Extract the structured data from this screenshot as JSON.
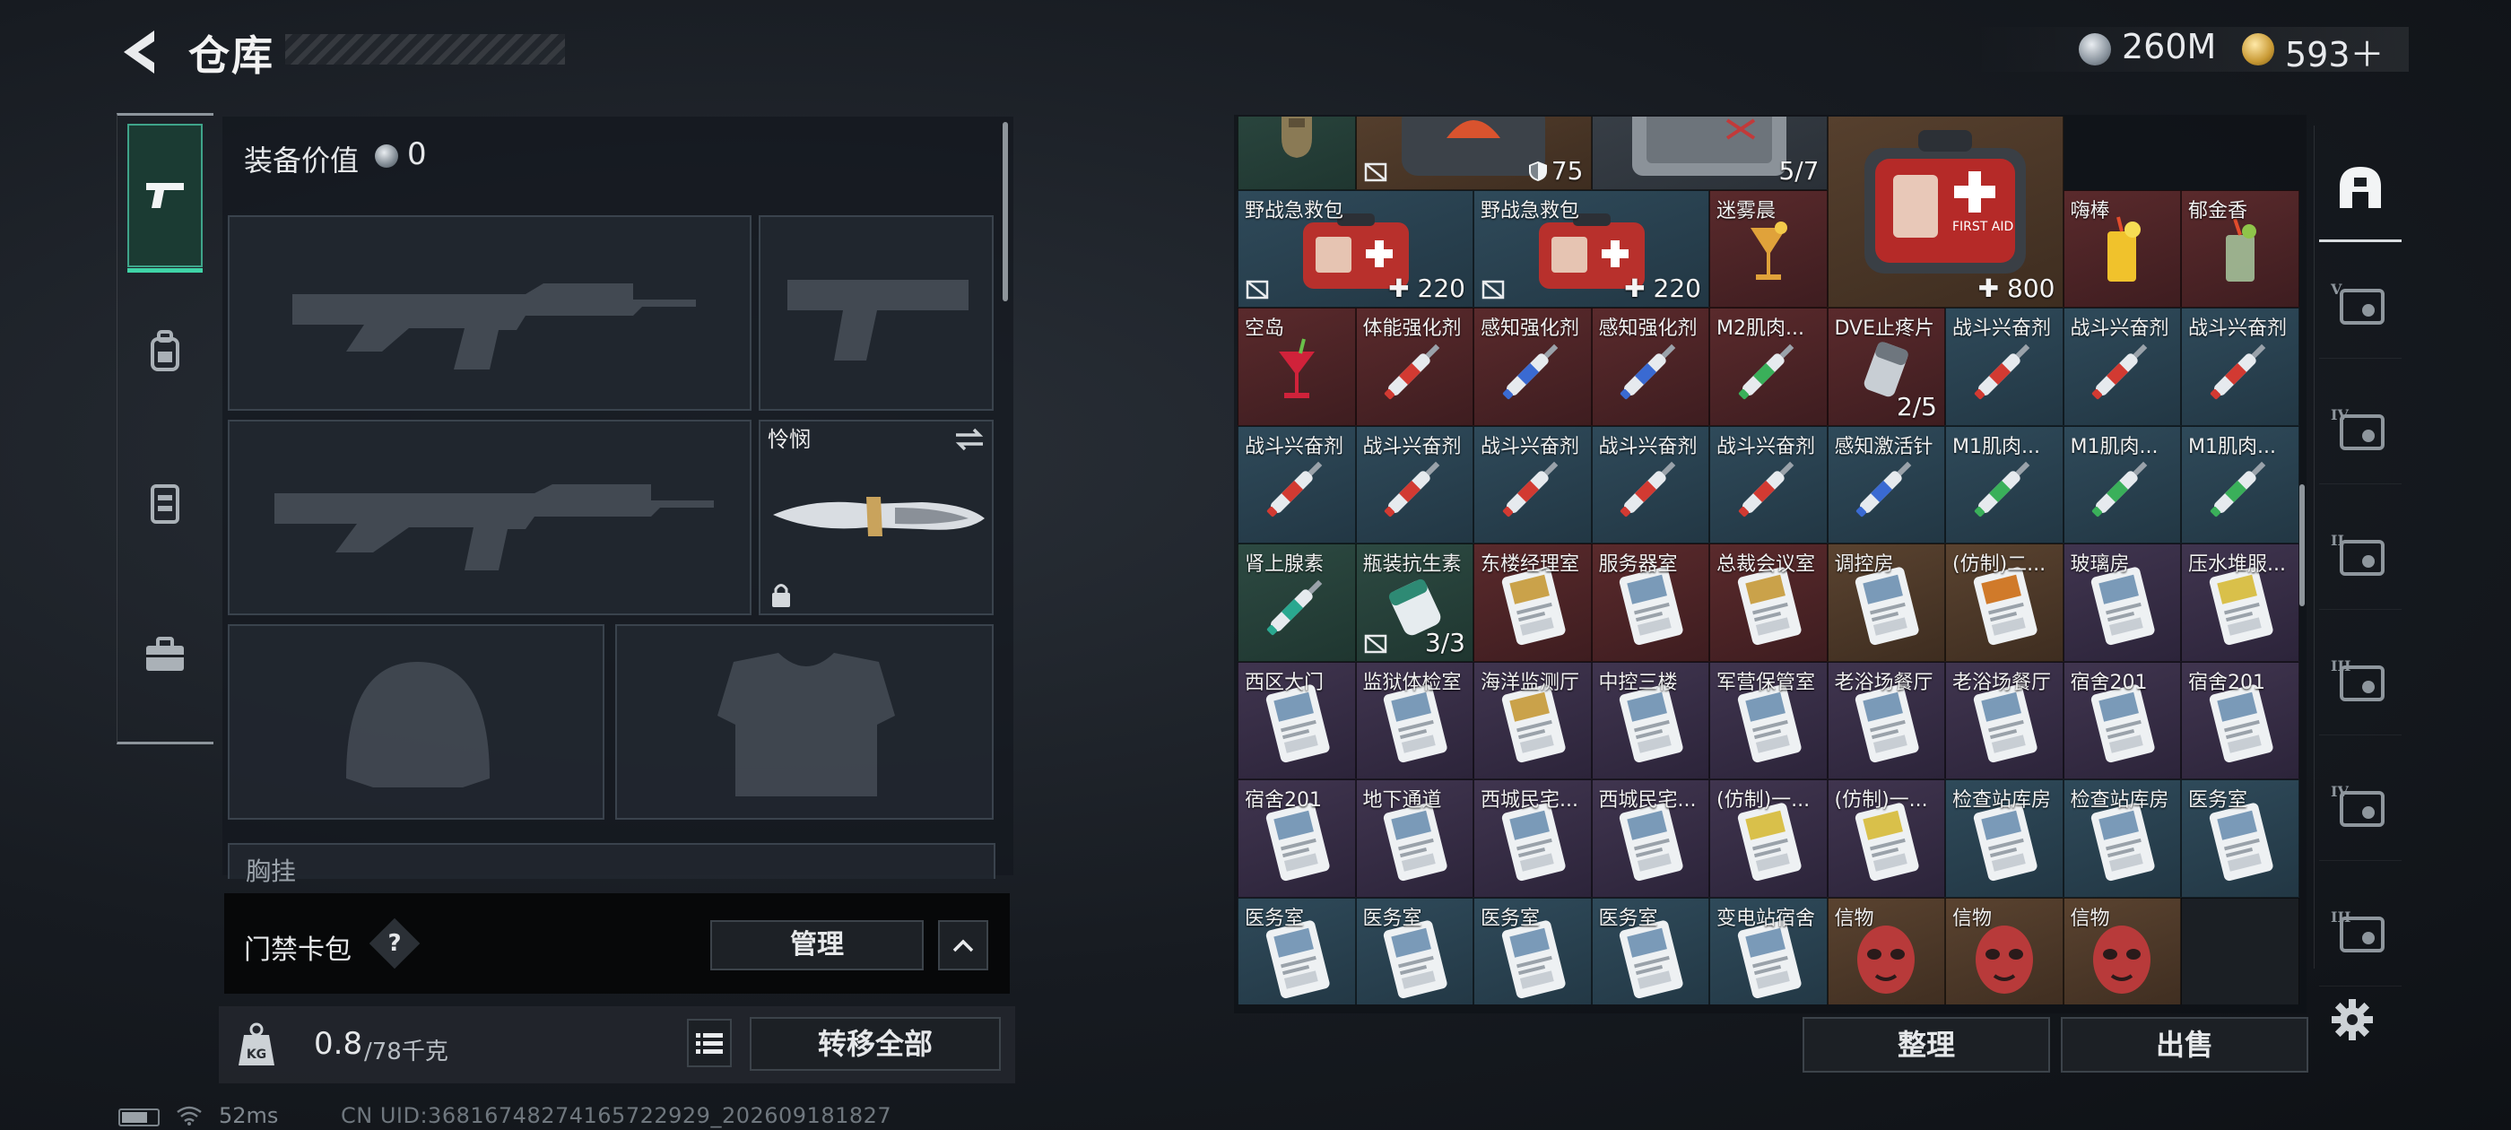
{
  "header": {
    "title": "仓库",
    "currency": [
      {
        "name": "silver",
        "icon": "silver-coin-icon",
        "value": "260M"
      },
      {
        "name": "gold",
        "icon": "gold-coin-icon",
        "value": "593＋"
      }
    ]
  },
  "left_rail": {
    "tabs": [
      {
        "icon": "pistol-icon",
        "active": true
      },
      {
        "icon": "backpack-icon",
        "active": false
      },
      {
        "icon": "vest-icon",
        "active": false
      },
      {
        "icon": "toolbox-icon",
        "active": false
      }
    ]
  },
  "loadout": {
    "equip_value_label": "装备价值",
    "equip_value": "0",
    "melee_name": "怜悯",
    "chest_rig_label": "胸挂",
    "keycard_label": "门禁卡包",
    "keycard_help": "?",
    "manage_label": "管理",
    "weight_current": "0.8",
    "weight_max": "/78千克",
    "transfer_all_label": "转移全部"
  },
  "stash": {
    "rows": [
      [
        {
          "name": "",
          "bg": "green",
          "art": "holster",
          "w": 1
        },
        {
          "name": "",
          "bg": "brown",
          "art": "bag",
          "w": 2,
          "count": "75",
          "badge": "shield",
          "no_retrieve": true
        },
        {
          "name": "",
          "bg": "gray",
          "art": "case",
          "w": 2,
          "count": "5/7"
        },
        {
          "name": "",
          "bg": "brown",
          "art": "firstaid-big",
          "w": 2,
          "h": 2,
          "count": "800",
          "plus": true
        }
      ],
      [
        {
          "name": "野战急救包",
          "bg": "blue",
          "art": "firstaid",
          "w": 2,
          "count": "220",
          "plus": true,
          "no_retrieve": true
        },
        {
          "name": "野战急救包",
          "bg": "blue",
          "art": "firstaid",
          "w": 2,
          "count": "220",
          "plus": true,
          "no_retrieve": true
        },
        {
          "name": "迷雾晨",
          "bg": "red",
          "art": "cocktail"
        },
        {
          "name": "嗨棒",
          "bg": "red",
          "art": "drink-yellow"
        },
        {
          "name": "郁金香",
          "bg": "red",
          "art": "drink-green"
        }
      ],
      [
        {
          "name": "空岛",
          "bg": "red",
          "art": "cocktail-red"
        },
        {
          "name": "体能强化剂",
          "bg": "red",
          "art": "inj-red"
        },
        {
          "name": "感知强化剂",
          "bg": "red",
          "art": "inj-blue"
        },
        {
          "name": "感知强化剂",
          "bg": "red",
          "art": "inj-blue"
        },
        {
          "name": "M2肌肉...",
          "bg": "red",
          "art": "inj-green"
        },
        {
          "name": "DVE止疼片",
          "bg": "red",
          "art": "pills",
          "count": "2/5"
        },
        {
          "name": "战斗兴奋剂",
          "bg": "blue",
          "art": "inj-red"
        },
        {
          "name": "战斗兴奋剂",
          "bg": "blue",
          "art": "inj-red"
        },
        {
          "name": "战斗兴奋剂",
          "bg": "blue",
          "art": "inj-red"
        }
      ],
      [
        {
          "name": "战斗兴奋剂",
          "bg": "blue",
          "art": "inj-red"
        },
        {
          "name": "战斗兴奋剂",
          "bg": "blue",
          "art": "inj-red"
        },
        {
          "name": "战斗兴奋剂",
          "bg": "blue",
          "art": "inj-red"
        },
        {
          "name": "战斗兴奋剂",
          "bg": "blue",
          "art": "inj-red"
        },
        {
          "name": "战斗兴奋剂",
          "bg": "blue",
          "art": "inj-red"
        },
        {
          "name": "感知激活针",
          "bg": "blue",
          "art": "inj-blue"
        },
        {
          "name": "M1肌肉...",
          "bg": "blue",
          "art": "inj-green"
        },
        {
          "name": "M1肌肉...",
          "bg": "blue",
          "art": "inj-green"
        },
        {
          "name": "M1肌肉...",
          "bg": "blue",
          "art": "inj-green"
        }
      ],
      [
        {
          "name": "肾上腺素",
          "bg": "green",
          "art": "inj-teal"
        },
        {
          "name": "瓶装抗生素",
          "bg": "green",
          "art": "bottle",
          "count": "3/3",
          "no_retrieve": true
        },
        {
          "name": "东楼经理室",
          "bg": "red",
          "art": "card-gold"
        },
        {
          "name": "服务器室",
          "bg": "red",
          "art": "card-blue"
        },
        {
          "name": "总裁会议室",
          "bg": "red",
          "art": "card-gold"
        },
        {
          "name": "调控房",
          "bg": "brown",
          "art": "card-blue"
        },
        {
          "name": "(仿制)二...",
          "bg": "brown",
          "art": "card-orange"
        },
        {
          "name": "玻璃房",
          "bg": "purple",
          "art": "card-blue"
        },
        {
          "name": "压水堆服...",
          "bg": "purple",
          "art": "card-yellow"
        }
      ],
      [
        {
          "name": "西区大门",
          "bg": "purple",
          "art": "card-blue"
        },
        {
          "name": "监狱体检室",
          "bg": "purple",
          "art": "card-blue"
        },
        {
          "name": "海洋监测厅",
          "bg": "purple",
          "art": "card-gold"
        },
        {
          "name": "中控三楼",
          "bg": "purple",
          "art": "card-blue"
        },
        {
          "name": "军营保管室",
          "bg": "purple",
          "art": "card-blue"
        },
        {
          "name": "老浴场餐厅",
          "bg": "purple",
          "art": "card-blue"
        },
        {
          "name": "老浴场餐厅",
          "bg": "purple",
          "art": "card-blue"
        },
        {
          "name": "宿舍201",
          "bg": "purple",
          "art": "card-blue"
        },
        {
          "name": "宿舍201",
          "bg": "purple",
          "art": "card-blue"
        }
      ],
      [
        {
          "name": "宿舍201",
          "bg": "purple",
          "art": "card-blue"
        },
        {
          "name": "地下通道",
          "bg": "purple",
          "art": "card-blue"
        },
        {
          "name": "西城民宅...",
          "bg": "purple",
          "art": "card-blue"
        },
        {
          "name": "西城民宅...",
          "bg": "purple",
          "art": "card-blue"
        },
        {
          "name": "(仿制)一...",
          "bg": "purple",
          "art": "card-yellow"
        },
        {
          "name": "(仿制)一...",
          "bg": "purple",
          "art": "card-yellow"
        },
        {
          "name": "检查站库房",
          "bg": "blue",
          "art": "card-blue"
        },
        {
          "name": "检查站库房",
          "bg": "blue",
          "art": "card-blue"
        },
        {
          "name": "医务室",
          "bg": "blue",
          "art": "card-blue"
        }
      ],
      [
        {
          "name": "医务室",
          "bg": "blue",
          "art": "card-blue"
        },
        {
          "name": "医务室",
          "bg": "blue",
          "art": "card-blue"
        },
        {
          "name": "医务室",
          "bg": "blue",
          "art": "card-blue"
        },
        {
          "name": "医务室",
          "bg": "blue",
          "art": "card-blue"
        },
        {
          "name": "变电站宿舍",
          "bg": "blue",
          "art": "card-blue"
        },
        {
          "name": "信物",
          "bg": "brown",
          "art": "mask"
        },
        {
          "name": "信物",
          "bg": "brown",
          "art": "mask"
        },
        {
          "name": "信物",
          "bg": "brown",
          "art": "mask"
        },
        {
          "name": "",
          "bg": "empty",
          "art": ""
        }
      ]
    ]
  },
  "right_rail": {
    "tabs": [
      {
        "icon": "all-items-icon",
        "active": true
      },
      {
        "icon": "tier-v-case-icon",
        "tier": "V"
      },
      {
        "icon": "tier-iv-case-icon",
        "tier": "IV"
      },
      {
        "icon": "tier-ii-folder-icon",
        "tier": "II"
      },
      {
        "icon": "tier-iii-pouch-icon",
        "tier": "III"
      },
      {
        "icon": "tier-iv-folder-icon",
        "tier": "IV"
      },
      {
        "icon": "tier-iii-pouch-icon",
        "tier": "III"
      }
    ]
  },
  "actions": {
    "organize_label": "整理",
    "sell_label": "出售"
  },
  "status_bar": {
    "ping": "52ms",
    "uid": "CN UID:3681674827416572292​9_202609181827"
  },
  "colors": {
    "accent": "#3fd4a7",
    "cell_gray": "#3b424a",
    "cell_blue": "#2f4a5a",
    "cell_red": "#5a2a2c",
    "cell_brown": "#5a4330",
    "cell_green": "#2d4a42",
    "cell_purple": "#40354f"
  }
}
